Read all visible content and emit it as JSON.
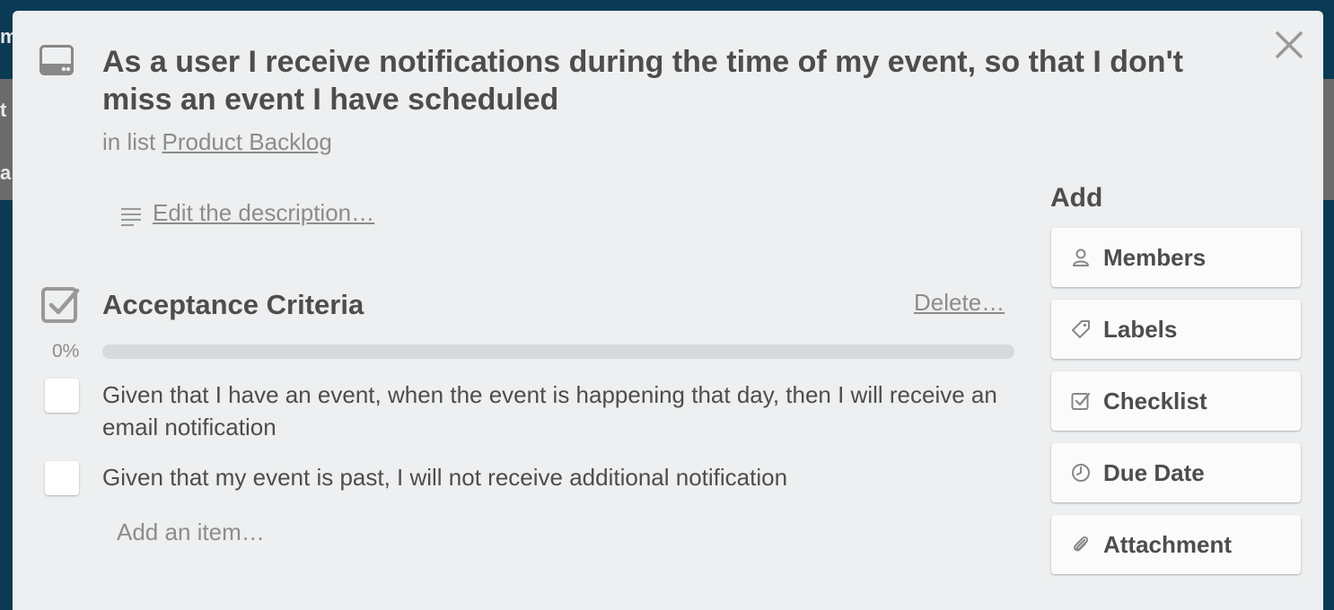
{
  "background": {
    "letter_m": "m",
    "letter_t": "t",
    "letter_a": "a"
  },
  "card": {
    "title": "As a user I receive notifications during the time of my event, so that I don't miss an event I have scheduled",
    "in_list_prefix": "in list",
    "list_name": "Product Backlog",
    "description_link": "Edit the description…",
    "close_icon": "close-icon"
  },
  "checklist": {
    "title": "Acceptance Criteria",
    "delete_label": "Delete…",
    "progress_label": "0%",
    "progress_fraction": 0,
    "items": [
      {
        "text": "Given that I have an event, when the event is happening that day, then I will receive an email notification",
        "checked": false
      },
      {
        "text": "Given that my event is past, I will not receive additional notification",
        "checked": false
      }
    ],
    "add_item_placeholder": "Add an item…"
  },
  "sidebar": {
    "title": "Add",
    "buttons": [
      {
        "label": "Members",
        "icon": "person-icon"
      },
      {
        "label": "Labels",
        "icon": "tag-icon"
      },
      {
        "label": "Checklist",
        "icon": "checkbox-icon"
      },
      {
        "label": "Due Date",
        "icon": "clock-icon"
      },
      {
        "label": "Attachment",
        "icon": "paperclip-icon"
      }
    ]
  },
  "colors": {
    "modal_bg": "#edeff0",
    "page_bg": "#0b3a55",
    "text": "#4d4d4d",
    "muted": "#8c8c8c",
    "progress_track": "#d6dadc"
  }
}
